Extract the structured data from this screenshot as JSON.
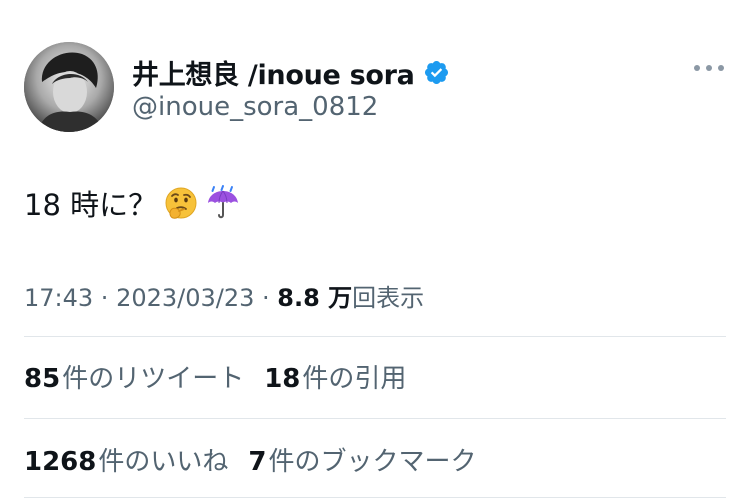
{
  "author": {
    "display_name": "井上想良 /inoue sora",
    "handle": "@inoue_sora_0812",
    "verified": true,
    "avatar_icon": "avatar-photo"
  },
  "tweet": {
    "text": "18 時に？",
    "emojis": [
      "thinking-face-emoji",
      "umbrella-with-rain-emoji"
    ]
  },
  "meta": {
    "time": "17:43",
    "separator": " · ",
    "date": "2023/03/23",
    "separator2": " · ",
    "views_count": "8.8 万",
    "views_label": "回表示"
  },
  "stats": {
    "retweets_count": "85",
    "retweets_label": "件のリツイート",
    "quotes_count": "18",
    "quotes_label": "件の引用",
    "likes_count": "1268",
    "likes_label": "件のいいね",
    "bookmarks_count": "7",
    "bookmarks_label": "件のブックマーク"
  },
  "colors": {
    "verified_blue": "#1d9bf0",
    "secondary_text": "#536471",
    "primary_text": "#0f1419"
  }
}
